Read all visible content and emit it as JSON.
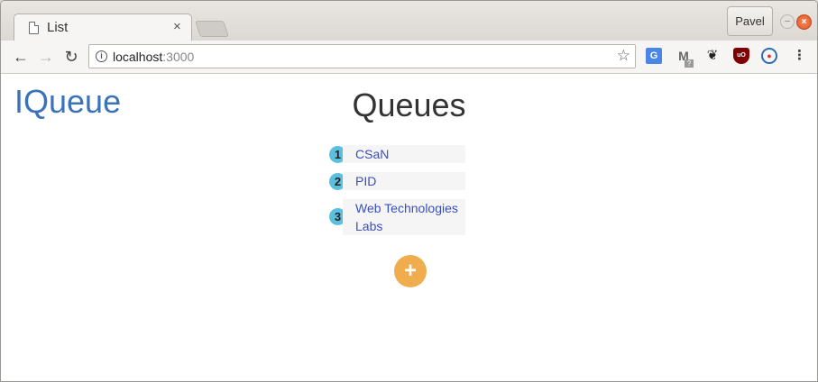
{
  "browser": {
    "tab_title": "List",
    "tab_close": "×",
    "profile_name": "Pavel",
    "url_host": "localhost",
    "url_port": ":3000",
    "menu_glyph": "⋮",
    "extensions": [
      "google-translate-icon",
      "gmail-checker-icon",
      "gnome-icon",
      "ublock-icon",
      "ring-extension-icon"
    ],
    "mail_badge": "?"
  },
  "page": {
    "logo": "IQueue",
    "title": "Queues",
    "queues": [
      {
        "number": "1",
        "name": "CSaN"
      },
      {
        "number": "2",
        "name": "PID"
      },
      {
        "number": "3",
        "name": "Web Technologies Labs"
      }
    ],
    "add_button": "+"
  },
  "colors": {
    "logo": "#3b73b9",
    "badge": "#5bc0de",
    "link": "#3a4fbf",
    "add_button": "#f0ad4e"
  }
}
